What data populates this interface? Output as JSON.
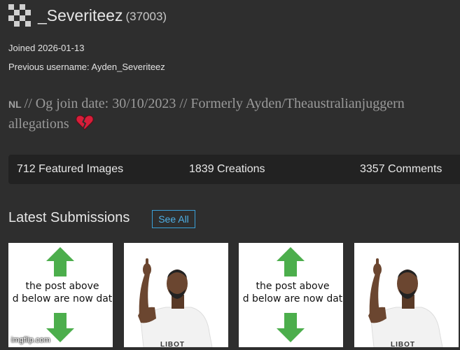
{
  "profile": {
    "username": "_Severiteez",
    "user_id": "(37003)",
    "joined": "Joined 2026-01-13",
    "previous_username": "Previous username: Ayden_Severiteez",
    "avatar_icon": "checker-avatar-icon"
  },
  "bio": {
    "flag": "NL",
    "line1": "// Og join date: 30/10/2023 // Formerly Ayden/Theaustralianjuggern",
    "line2": "allegations",
    "emoji_icon": "broken-heart-icon"
  },
  "stats": [
    {
      "label": "712 Featured Images"
    },
    {
      "label": "1839 Creations"
    },
    {
      "label": "3357 Comments"
    }
  ],
  "latest": {
    "title": "Latest Submissions",
    "see_all": "See All"
  },
  "thumbnails": [
    {
      "kind": "arrows",
      "line1": "the post above",
      "line2": "d below are now dat",
      "icons": [
        "green-up-arrow-icon",
        "green-down-arrow-icon"
      ]
    },
    {
      "kind": "man-pointing",
      "caption": "LIBOT"
    },
    {
      "kind": "arrows",
      "line1": "the post above",
      "line2": "d below are now dat",
      "icons": [
        "green-up-arrow-icon",
        "green-down-arrow-icon"
      ]
    },
    {
      "kind": "man-pointing",
      "caption": "LIBOT"
    }
  ],
  "watermark": "imgflip.com",
  "colors": {
    "background": "#2e2e2e",
    "stats_bar": "#222222",
    "accent_link": "#3aa0d8",
    "arrow_green": "#4cae4c"
  }
}
